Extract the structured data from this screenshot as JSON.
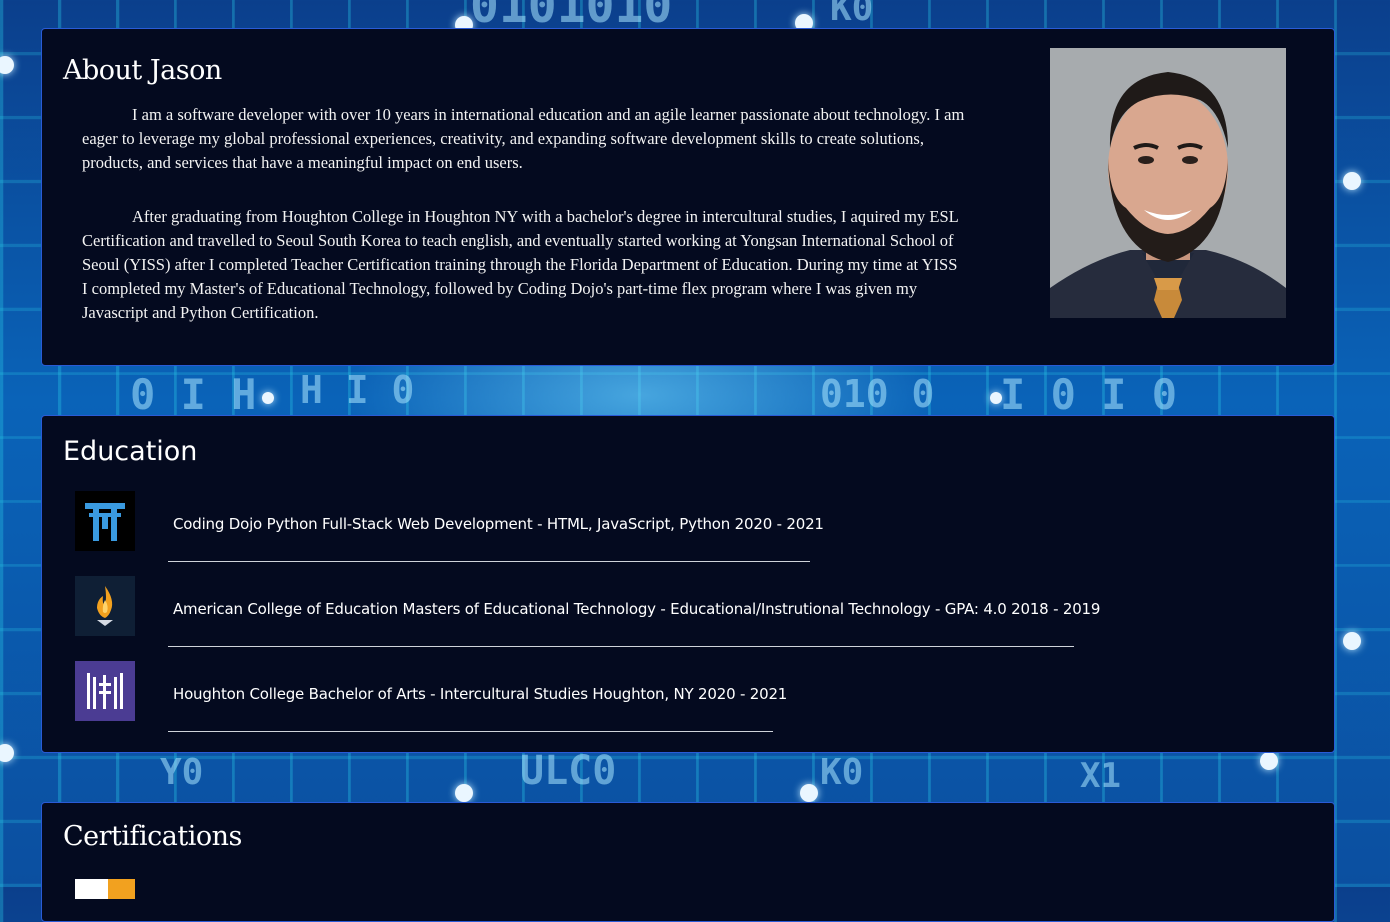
{
  "about": {
    "title": "About Jason",
    "paragraphs": [
      "I am a software developer with over 10 years in international education and an agile learner passionate about technology. I am eager to leverage my global professional experiences, creativity, and expanding software development skills to create solutions, products, and services that have a meaningful impact on end users.",
      "After graduating from Houghton College in Houghton NY with a bachelor's degree in intercultural studies, I aquired my ESL Certification and travelled to Seoul South Korea to teach english, and eventually started working at Yongsan International School of Seoul (YISS) after I completed Teacher Certification training through the Florida Department of Education. During my time at YISS I completed my Master's of Educational Technology, followed by Coding Dojo's part-time flex program where I was given my Javascript and Python Certification."
    ]
  },
  "education": {
    "title": "Education",
    "items": [
      {
        "text": "Coding Dojo Python Full-Stack Web Development - HTML, JavaScript, Python 2020 - 2021",
        "logo": "torii-gate-icon",
        "color": "#2f8fd6"
      },
      {
        "text": "American College of Education Masters of Educational Technology - Educational/Instrutional Technology - GPA: 4.0 2018 - 2019",
        "logo": "flame-icon",
        "color": "#f2a11f"
      },
      {
        "text": "Houghton College Bachelor of Arts - Intercultural Studies Houghton, NY 2020 - 2021",
        "logo": "houghton-h-icon",
        "color": "#4b3c93"
      }
    ]
  },
  "certifications": {
    "title": "Certifications"
  },
  "colors": {
    "card_bg": "#040a1f",
    "card_border": "#2a5bd6",
    "text": "#ffffff"
  }
}
